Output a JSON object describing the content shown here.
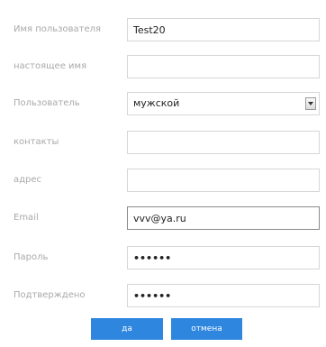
{
  "form": {
    "username": {
      "label": "Имя пользователя",
      "value": "Test20"
    },
    "realname": {
      "label": "настоящее имя",
      "value": ""
    },
    "gender": {
      "label": "Пользователь",
      "value": "мужской"
    },
    "contacts": {
      "label": "контакты",
      "value": ""
    },
    "address": {
      "label": "адрес",
      "value": ""
    },
    "email": {
      "label": "Email",
      "value": "vvv@ya.ru"
    },
    "password": {
      "label": "Пароль",
      "value": "••••••"
    },
    "confirm": {
      "label": "Подтверждено",
      "value": "••••••"
    }
  },
  "buttons": {
    "ok_label": "да",
    "cancel_label": "отмена"
  }
}
